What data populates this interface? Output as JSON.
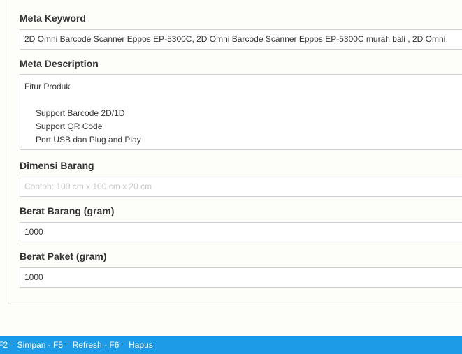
{
  "form": {
    "meta_keyword": {
      "label": "Meta Keyword",
      "value": "2D Omni Barcode Scanner Eppos EP-5300C, 2D Omni Barcode Scanner Eppos EP-5300C murah bali , 2D Omni"
    },
    "meta_description": {
      "label": "Meta Description",
      "lines": [
        "Fitur Produk",
        "",
        "Support Barcode 2D/1D",
        "Support QR Code",
        "Port USB dan Plug and Play"
      ]
    },
    "dimensi_barang": {
      "label": "Dimensi Barang",
      "placeholder": "Contoh: 100 cm x 100 cm x 20 cm",
      "value": ""
    },
    "berat_barang": {
      "label": "Berat Barang (gram)",
      "value": "1000"
    },
    "berat_paket": {
      "label": "Berat Paket (gram)",
      "value": "1000"
    }
  },
  "footer": {
    "shortcuts": "F2 = Simpan - F5 = Refresh - F6 = Hapus"
  }
}
